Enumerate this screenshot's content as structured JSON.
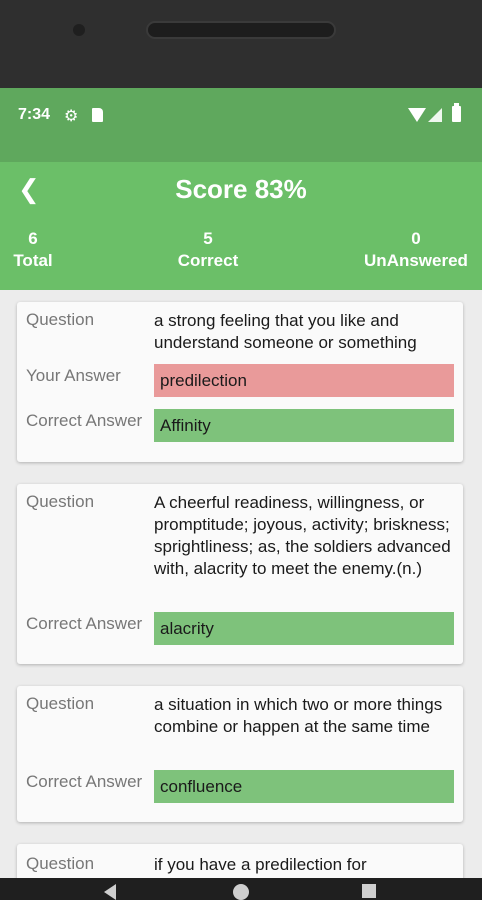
{
  "status_bar": {
    "time": "7:34"
  },
  "header": {
    "back_icon": "arrow-left-icon",
    "title": "Score 83%",
    "stats": [
      {
        "value": "6",
        "label": "Total"
      },
      {
        "value": "5",
        "label": "Correct"
      },
      {
        "value": "0",
        "label": "UnAnswered"
      }
    ]
  },
  "labels": {
    "question": "Question",
    "your_answer": "Your Answer",
    "correct_answer": "Correct Answer"
  },
  "cards": [
    {
      "question": "a strong feeling that you like and understand someone or something",
      "your_answer": "predilection",
      "correct_answer": "Affinity"
    },
    {
      "question": "A cheerful readiness, willingness, or promptitude; joyous, activity; briskness; sprightliness; as, the soldiers advanced with, alacrity to meet the enemy.(n.)",
      "correct_answer": "alacrity"
    },
    {
      "question": "a situation in which two or more things combine or happen at the same time",
      "correct_answer": "confluence"
    },
    {
      "question": "if you have a predilection for"
    }
  ],
  "colors": {
    "header": "#6bbf68",
    "status_bar": "#5fa85d",
    "wrong": "#e99a9a",
    "correct": "#7ec27b"
  }
}
